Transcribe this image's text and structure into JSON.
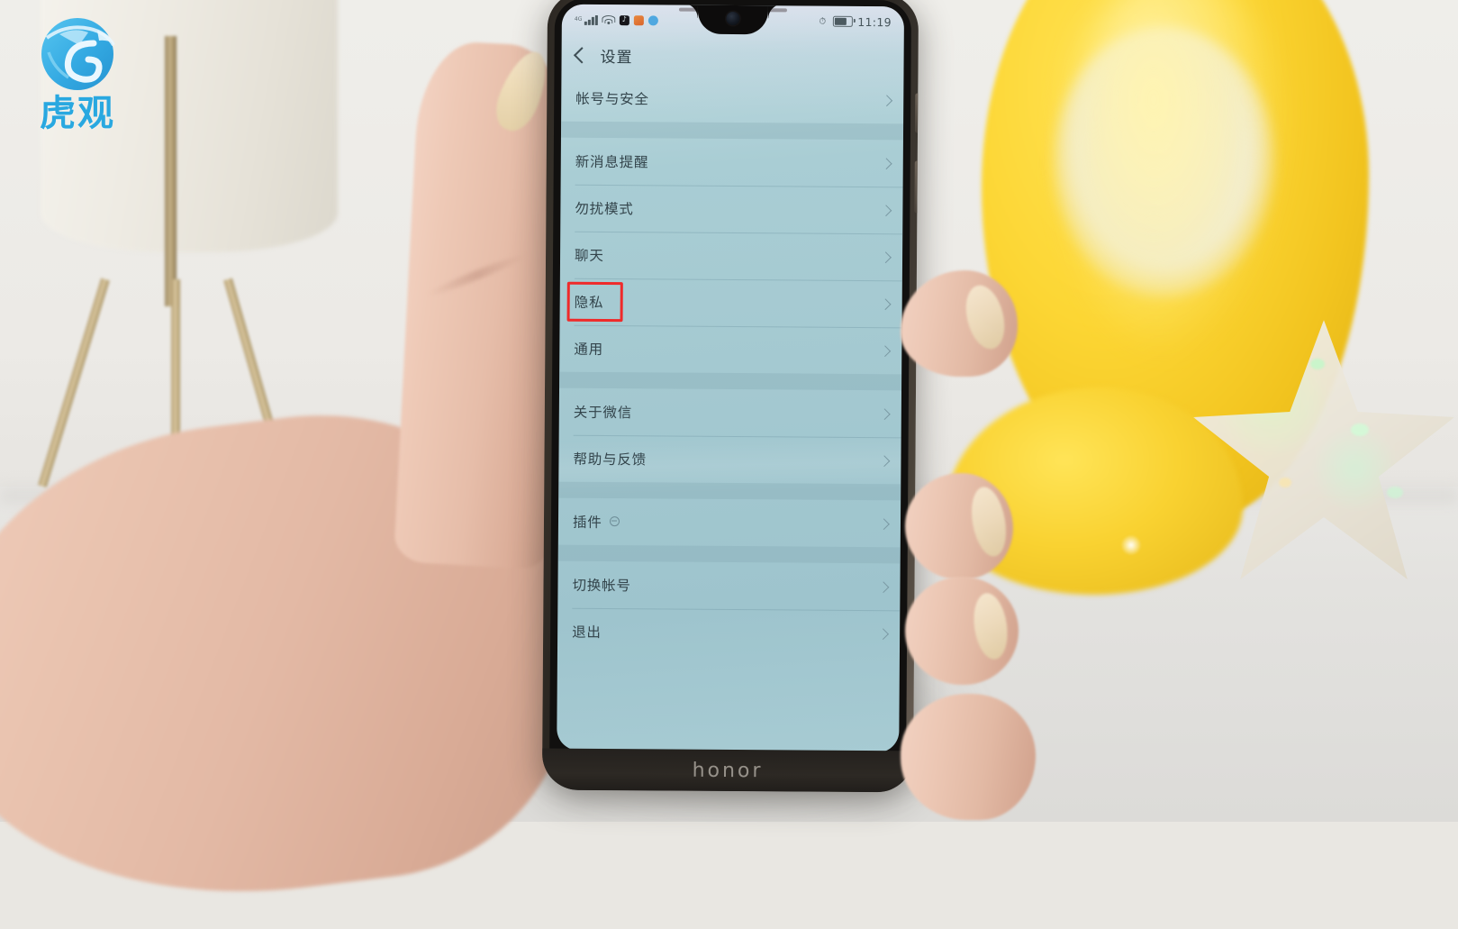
{
  "watermark": {
    "brand_text": "虎观",
    "logo_icon": "tiger-globe-logo",
    "color": "#29a8e0"
  },
  "device": {
    "brand_label": "honor",
    "notch_icon": "waterdrop-notch-front-camera"
  },
  "statusbar": {
    "signal_label": "",
    "icons": [
      {
        "name": "signal-bars-icon"
      },
      {
        "name": "wifi-icon"
      },
      {
        "name": "tiktok-app-icon"
      },
      {
        "name": "orange-app-icon"
      },
      {
        "name": "blue-app-icon"
      }
    ],
    "right_icons": [
      {
        "name": "alarm-bell-icon"
      },
      {
        "name": "battery-icon"
      }
    ],
    "time": "11:19"
  },
  "nav": {
    "back_icon": "back-chevron-icon",
    "title": "设置"
  },
  "list": {
    "groups": [
      {
        "items": [
          {
            "label": "帐号与安全",
            "chevron": "chevron-right-icon",
            "badge": false,
            "highlighted": false
          }
        ]
      },
      {
        "items": [
          {
            "label": "新消息提醒",
            "chevron": "chevron-right-icon",
            "badge": false,
            "highlighted": false
          },
          {
            "label": "勿扰模式",
            "chevron": "chevron-right-icon",
            "badge": false,
            "highlighted": false
          },
          {
            "label": "聊天",
            "chevron": "chevron-right-icon",
            "badge": false,
            "highlighted": false
          },
          {
            "label": "隐私",
            "chevron": "chevron-right-icon",
            "badge": false,
            "highlighted": true
          },
          {
            "label": "通用",
            "chevron": "chevron-right-icon",
            "badge": false,
            "highlighted": false
          }
        ]
      },
      {
        "items": [
          {
            "label": "关于微信",
            "chevron": "chevron-right-icon",
            "badge": false,
            "highlighted": false
          },
          {
            "label": "帮助与反馈",
            "chevron": "chevron-right-icon",
            "badge": false,
            "highlighted": false
          }
        ]
      },
      {
        "items": [
          {
            "label": "插件",
            "chevron": "chevron-right-icon",
            "badge": true,
            "highlighted": false
          }
        ]
      },
      {
        "items": [
          {
            "label": "切换帐号",
            "chevron": "chevron-right-icon",
            "badge": false,
            "highlighted": false
          },
          {
            "label": "退出",
            "chevron": "chevron-right-icon",
            "badge": false,
            "highlighted": false
          }
        ]
      }
    ]
  },
  "annotation": {
    "highlight_color": "#ef2a2a",
    "highlight_target": "隐私"
  },
  "scene": {
    "objects": [
      {
        "name": "table-lamp",
        "color": "#eeebe3"
      },
      {
        "name": "yellow-vase",
        "color": "#f8d234"
      },
      {
        "name": "glitter-star-ornament",
        "color": "#eae5d8"
      },
      {
        "name": "hand-holding-phone",
        "color": "#e8c3b0"
      }
    ]
  }
}
